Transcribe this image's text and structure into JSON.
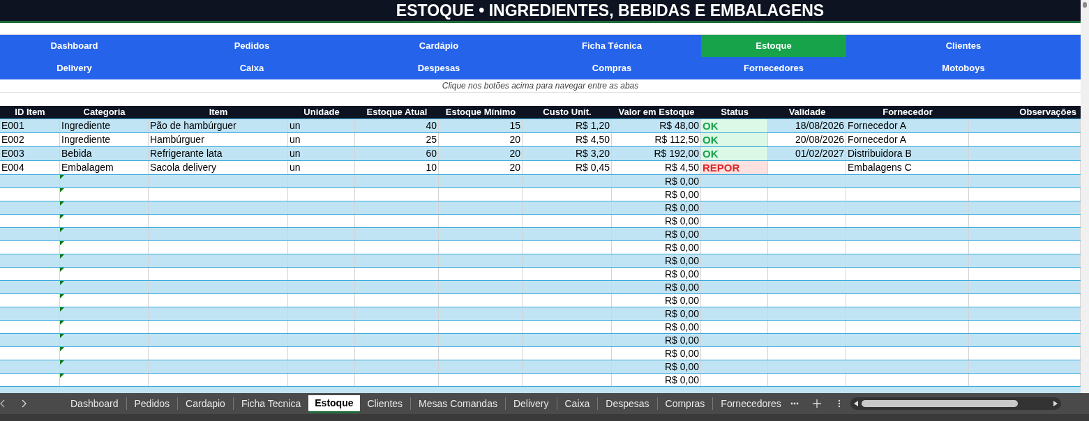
{
  "title": "ESTOQUE • INGREDIENTES, BEBIDAS E EMBALAGENS",
  "nav": [
    [
      {
        "label": "Dashboard",
        "selected": false
      },
      {
        "label": "Pedidos",
        "selected": false
      },
      {
        "label": "Cardápio",
        "selected": false
      },
      {
        "label": "Ficha Técnica",
        "selected": false
      },
      {
        "label": "Estoque",
        "selected": true
      },
      {
        "label": "Clientes",
        "selected": false
      }
    ],
    [
      {
        "label": "Delivery",
        "selected": false
      },
      {
        "label": "Caixa",
        "selected": false
      },
      {
        "label": "Despesas",
        "selected": false
      },
      {
        "label": "Compras",
        "selected": false
      },
      {
        "label": "Fornecedores",
        "selected": false
      },
      {
        "label": "Motoboys",
        "selected": false
      }
    ]
  ],
  "hint": "Clique nos botões acima para navegar entre as abas",
  "columns": [
    "ID Item",
    "Categoria",
    "Item",
    "Unidade",
    "Estoque Atual",
    "Estoque Mínimo",
    "Custo Unit.",
    "Valor em Estoque",
    "Status",
    "Validade",
    "Fornecedor",
    "Observações"
  ],
  "rows": [
    {
      "id": "E001",
      "categoria": "Ingrediente",
      "item": "Pão de hambúrguer",
      "unidade": "un",
      "atual": "40",
      "minimo": "15",
      "custo": "R$ 1,20",
      "valor": "R$ 48,00",
      "status": {
        "label": "OK",
        "kind": "ok"
      },
      "validade": "18/08/2026",
      "fornecedor": "Fornecedor A"
    },
    {
      "id": "E002",
      "categoria": "Ingrediente",
      "item": "Hambúrguer",
      "unidade": "un",
      "atual": "25",
      "minimo": "20",
      "custo": "R$ 4,50",
      "valor": "R$ 112,50",
      "status": {
        "label": "OK",
        "kind": "ok"
      },
      "validade": "20/08/2026",
      "fornecedor": "Fornecedor A"
    },
    {
      "id": "E003",
      "categoria": "Bebida",
      "item": "Refrigerante lata",
      "unidade": "un",
      "atual": "60",
      "minimo": "20",
      "custo": "R$ 3,20",
      "valor": "R$ 192,00",
      "status": {
        "label": "OK",
        "kind": "ok"
      },
      "validade": "01/02/2027",
      "fornecedor": "Distribuidora B"
    },
    {
      "id": "E004",
      "categoria": "Embalagem",
      "item": "Sacola delivery",
      "unidade": "un",
      "atual": "10",
      "minimo": "20",
      "custo": "R$ 0,45",
      "valor": "R$ 4,50",
      "status": {
        "label": "REPOR",
        "kind": "repor"
      },
      "fornecedor": "Embalagens C"
    }
  ],
  "empty_rows": [
    "R$ 0,00",
    "R$ 0,00",
    "R$ 0,00",
    "R$ 0,00",
    "R$ 0,00",
    "R$ 0,00",
    "R$ 0,00",
    "R$ 0,00",
    "R$ 0,00",
    "R$ 0,00",
    "R$ 0,00",
    "R$ 0,00",
    "R$ 0,00",
    "R$ 0,00",
    "R$ 0,00",
    "R$ 0,00"
  ],
  "sheet_tabs": [
    {
      "label": "Dashboard",
      "selected": false
    },
    {
      "label": "Pedidos",
      "selected": false
    },
    {
      "label": "Cardapio",
      "selected": false
    },
    {
      "label": "Ficha Tecnica",
      "selected": false
    },
    {
      "label": "Estoque",
      "selected": true
    },
    {
      "label": "Clientes",
      "selected": false
    },
    {
      "label": "Mesas Comandas",
      "selected": false
    },
    {
      "label": "Delivery",
      "selected": false
    },
    {
      "label": "Caixa",
      "selected": false
    },
    {
      "label": "Despesas",
      "selected": false
    },
    {
      "label": "Compras",
      "selected": false
    },
    {
      "label": "Fornecedores",
      "selected": false
    }
  ]
}
